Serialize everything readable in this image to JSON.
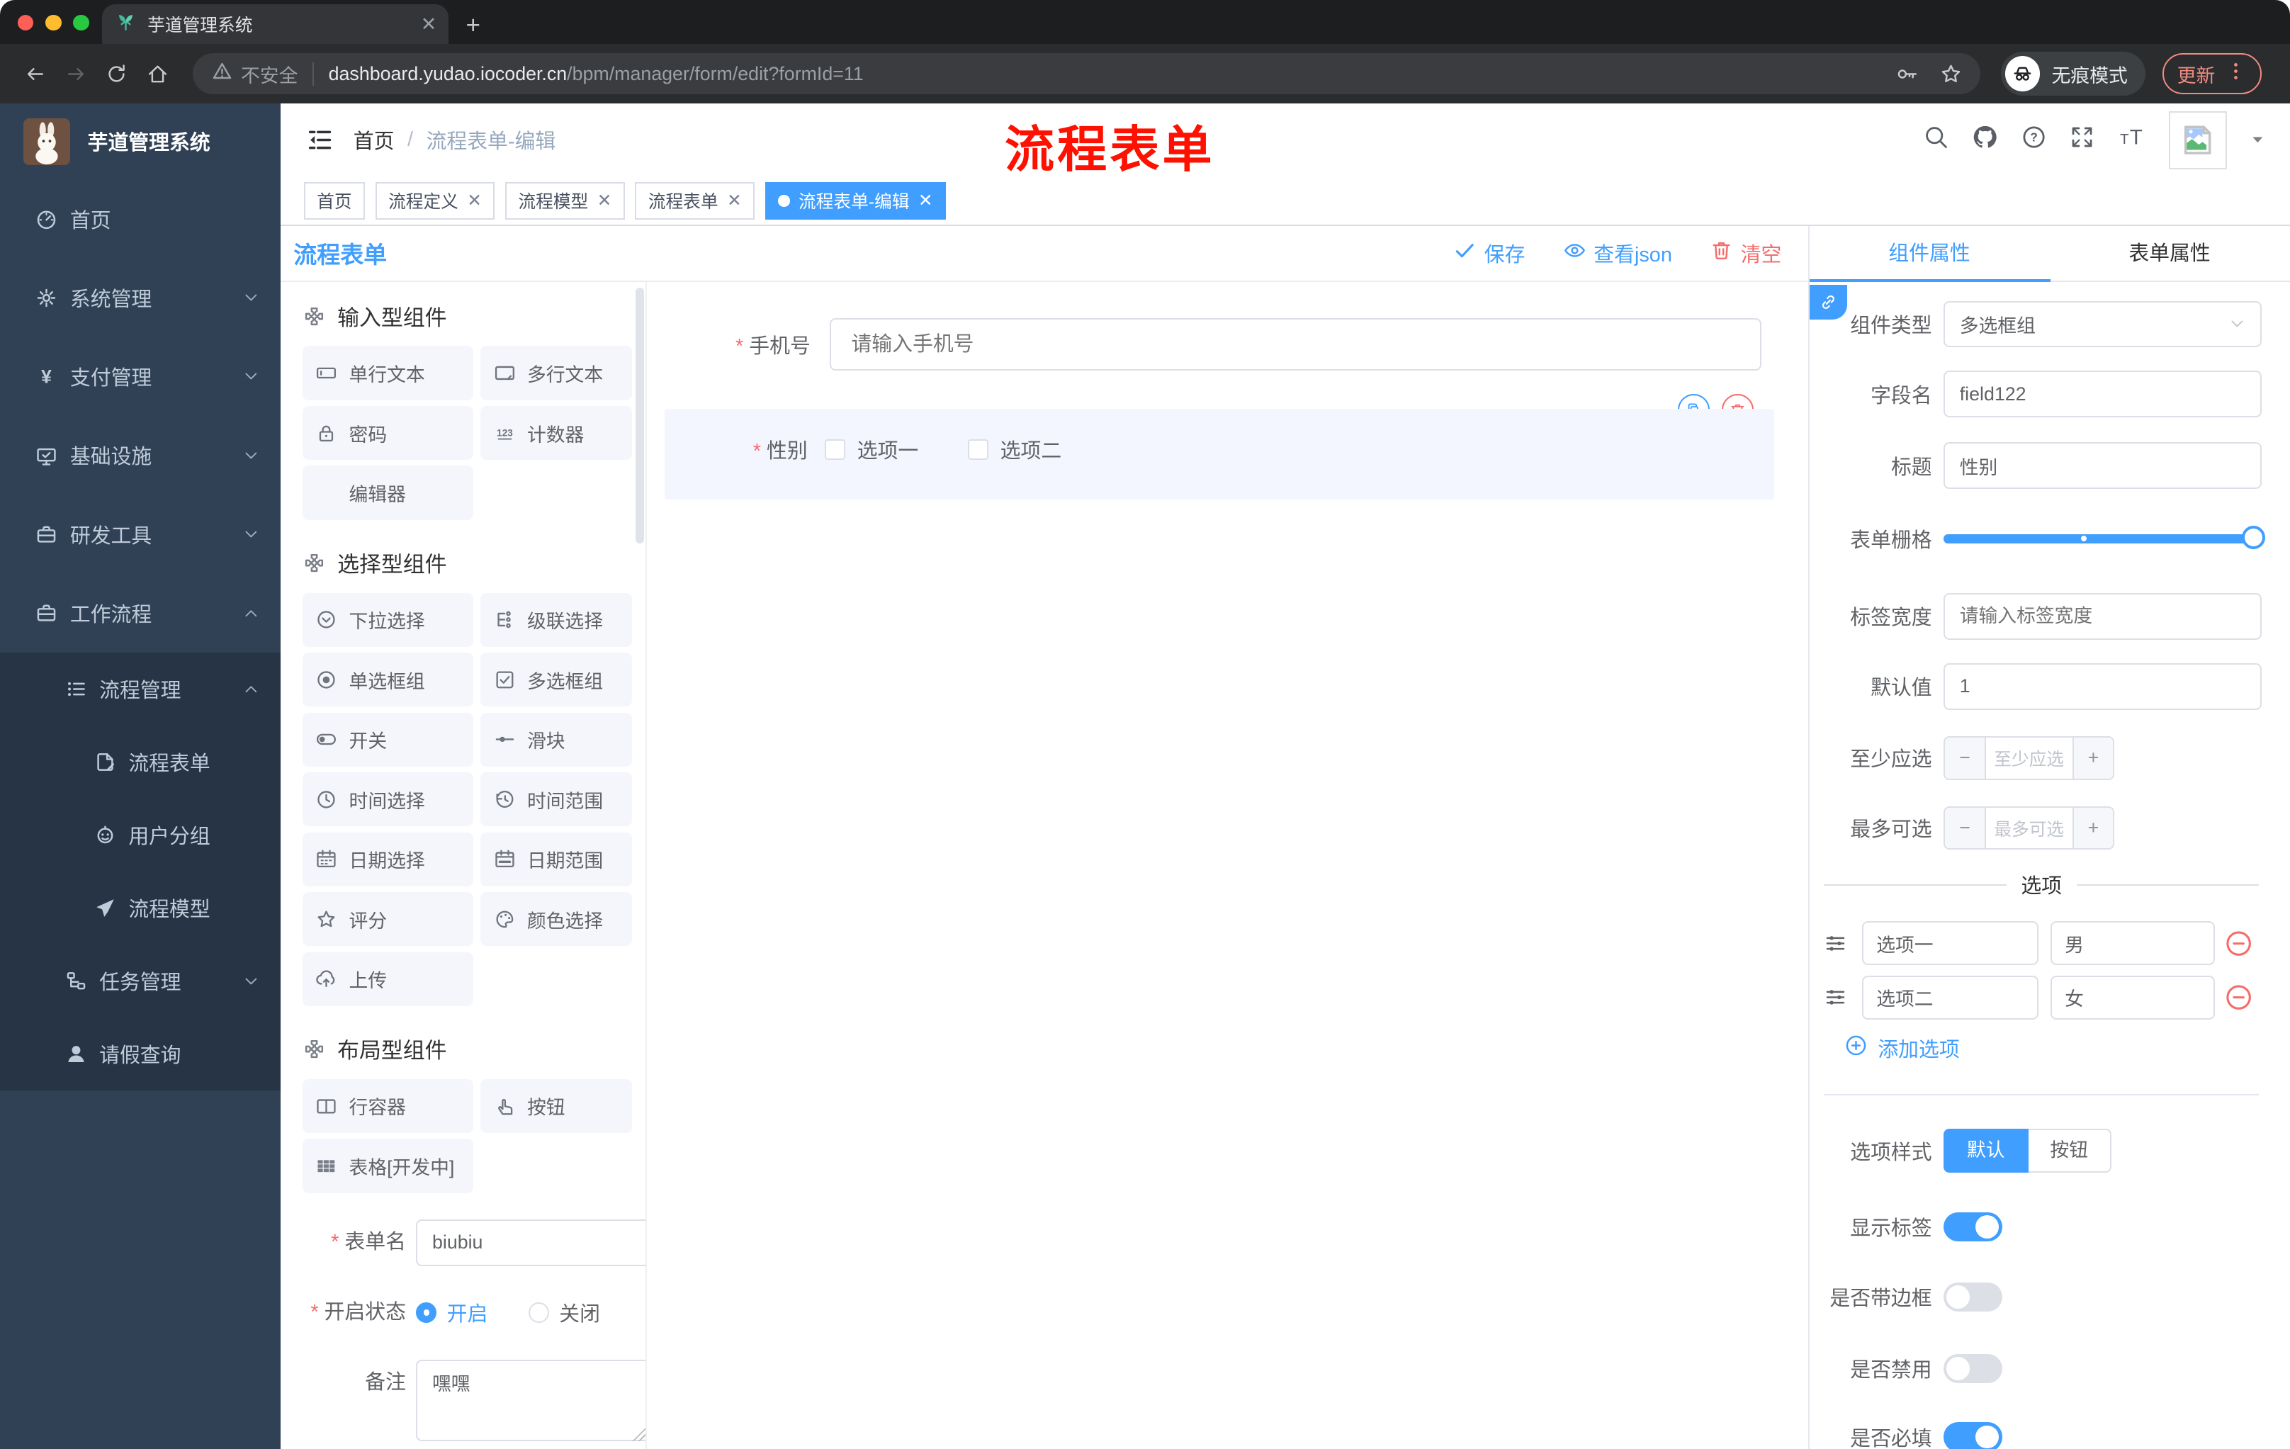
{
  "window": {
    "tab_title": "芋道管理系统",
    "url_security": "不安全",
    "url_host": "dashboard.yudao.iocoder.cn",
    "url_path": "/bpm/manager/form/edit?formId=11",
    "incognito_label": "无痕模式",
    "update_label": "更新"
  },
  "sidebar": {
    "logo_title": "芋道管理系统",
    "menu": [
      {
        "label": "首页",
        "icon": "dashboard",
        "chevron": ""
      },
      {
        "label": "系统管理",
        "icon": "gear",
        "chevron": "down"
      },
      {
        "label": "支付管理",
        "icon": "yen",
        "chevron": "down"
      },
      {
        "label": "基础设施",
        "icon": "monitor",
        "chevron": "down"
      },
      {
        "label": "研发工具",
        "icon": "briefcase",
        "chevron": "down"
      },
      {
        "label": "工作流程",
        "icon": "briefcase",
        "chevron": "up"
      }
    ],
    "submenu": [
      {
        "label": "流程管理",
        "icon": "tree-list",
        "chevron": "up",
        "indent": 1
      },
      {
        "label": "流程表单",
        "icon": "doc-edit",
        "chevron": "",
        "indent": 2
      },
      {
        "label": "用户分组",
        "icon": "robot",
        "chevron": "",
        "indent": 2
      },
      {
        "label": "流程模型",
        "icon": "plane",
        "chevron": "",
        "indent": 2
      },
      {
        "label": "任务管理",
        "icon": "org",
        "chevron": "down",
        "indent": 1
      },
      {
        "label": "请假查询",
        "icon": "user",
        "chevron": "",
        "indent": 1
      }
    ]
  },
  "header": {
    "breadcrumb_home": "首页",
    "breadcrumb_current": "流程表单-编辑",
    "annotation": "流程表单"
  },
  "tags": [
    {
      "label": "首页",
      "closable": false,
      "active": false
    },
    {
      "label": "流程定义",
      "closable": true,
      "active": false
    },
    {
      "label": "流程模型",
      "closable": true,
      "active": false
    },
    {
      "label": "流程表单",
      "closable": true,
      "active": false
    },
    {
      "label": "流程表单-编辑",
      "closable": true,
      "active": true
    }
  ],
  "toolbar": {
    "title": "流程表单",
    "save": "保存",
    "view_json": "查看json",
    "clear": "清空"
  },
  "components": {
    "groups": [
      {
        "title": "输入型组件",
        "items": [
          {
            "label": "单行文本",
            "icon": "input"
          },
          {
            "label": "多行文本",
            "icon": "textarea"
          },
          {
            "label": "密码",
            "icon": "lock"
          },
          {
            "label": "计数器",
            "icon": "counter"
          },
          {
            "label": "编辑器",
            "icon": "none"
          }
        ]
      },
      {
        "title": "选择型组件",
        "items": [
          {
            "label": "下拉选择",
            "icon": "select"
          },
          {
            "label": "级联选择",
            "icon": "cascade"
          },
          {
            "label": "单选框组",
            "icon": "radio"
          },
          {
            "label": "多选框组",
            "icon": "checkbox"
          },
          {
            "label": "开关",
            "icon": "switch"
          },
          {
            "label": "滑块",
            "icon": "slider"
          },
          {
            "label": "时间选择",
            "icon": "time"
          },
          {
            "label": "时间范围",
            "icon": "time-range"
          },
          {
            "label": "日期选择",
            "icon": "date"
          },
          {
            "label": "日期范围",
            "icon": "date-range"
          },
          {
            "label": "评分",
            "icon": "star"
          },
          {
            "label": "颜色选择",
            "icon": "color"
          },
          {
            "label": "上传",
            "icon": "upload"
          }
        ]
      },
      {
        "title": "布局型组件",
        "items": [
          {
            "label": "行容器",
            "icon": "row"
          },
          {
            "label": "按钮",
            "icon": "hand"
          },
          {
            "label": "表格[开发中]",
            "icon": "table"
          }
        ]
      }
    ]
  },
  "form_meta": {
    "name_label": "表单名",
    "name_value": "biubiu",
    "status_label": "开启状态",
    "status_on": "开启",
    "status_off": "关闭",
    "remark_label": "备注",
    "remark_value": "嘿嘿"
  },
  "canvas": {
    "phone_label": "手机号",
    "phone_placeholder": "请输入手机号",
    "gender_label": "性别",
    "gender_options": [
      "选项一",
      "选项二"
    ]
  },
  "props": {
    "tab_component": "组件属性",
    "tab_form": "表单属性",
    "type_label": "组件类型",
    "type_value": "多选框组",
    "field_label": "字段名",
    "field_value": "field122",
    "title_label": "标题",
    "title_value": "性别",
    "grid_label": "表单栅格",
    "width_label": "标签宽度",
    "width_placeholder": "请输入标签宽度",
    "default_label": "默认值",
    "default_value": "1",
    "min_label": "至少应选",
    "min_placeholder": "至少应选",
    "max_label": "最多可选",
    "max_placeholder": "最多可选",
    "options_title": "选项",
    "options": [
      {
        "name": "选项一",
        "value": "男"
      },
      {
        "name": "选项二",
        "value": "女"
      }
    ],
    "add_option": "添加选项",
    "style_label": "选项样式",
    "style_options": [
      "默认",
      "按钮"
    ],
    "style_selected": "默认",
    "toggles": [
      {
        "label": "显示标签",
        "on": true
      },
      {
        "label": "是否带边框",
        "on": false
      },
      {
        "label": "是否禁用",
        "on": false
      },
      {
        "label": "是否必填",
        "on": true
      }
    ]
  },
  "colors": {
    "primary": "#409eff",
    "danger": "#f56c6c",
    "annotation_red": "#fe1100",
    "sidebar_bg": "#304156",
    "submenu_bg": "#263445",
    "selected_block_bg": "#f4f6ff",
    "chip_bg": "#f4f6fc",
    "update_button": "#f28b82"
  }
}
